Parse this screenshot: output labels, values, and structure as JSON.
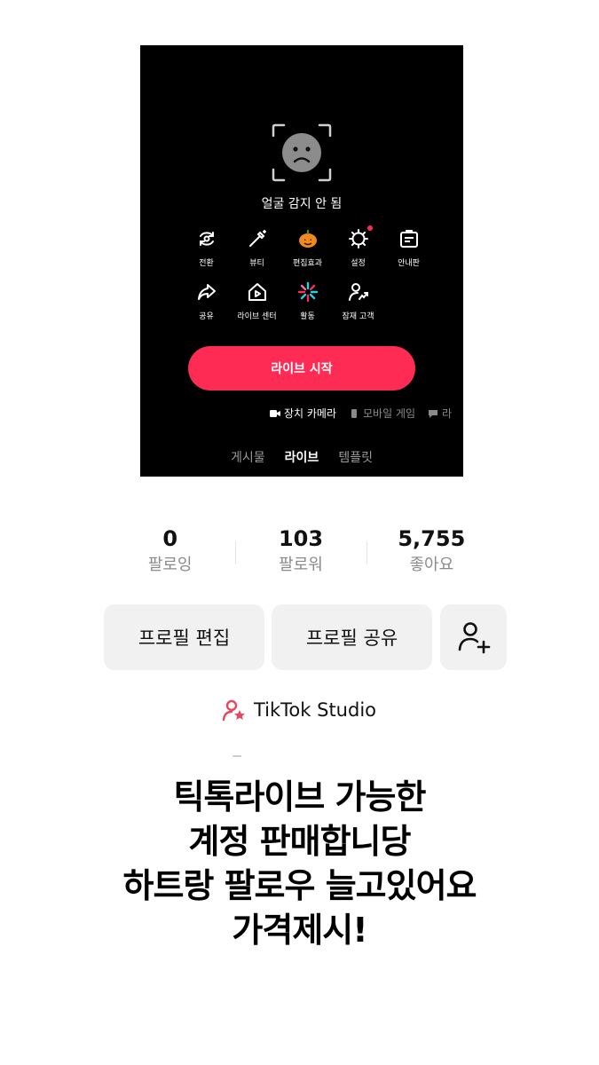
{
  "preview": {
    "face_message": "얼굴 감지 안 됨",
    "tools": [
      {
        "label": "전환",
        "icon": "camera-flip-icon",
        "dot": false
      },
      {
        "label": "뷰티",
        "icon": "magic-wand-icon",
        "dot": false
      },
      {
        "label": "편집효과",
        "icon": "pumpkin-effect-icon",
        "dot": false
      },
      {
        "label": "설정",
        "icon": "gear-icon",
        "dot": true
      },
      {
        "label": "안내판",
        "icon": "notice-board-icon",
        "dot": false
      },
      {
        "label": "공유",
        "icon": "share-arrow-icon",
        "dot": false
      },
      {
        "label": "라이브 센터",
        "icon": "live-center-home-icon",
        "dot": false
      },
      {
        "label": "활동",
        "icon": "activity-burst-icon",
        "dot": false
      },
      {
        "label": "잠재 고객",
        "icon": "potential-audience-icon",
        "dot": false
      }
    ],
    "go_live_label": "라이브 시작",
    "sources": [
      {
        "label": "장치 카메라",
        "icon": "video-camera-icon",
        "active": true
      },
      {
        "label": "모바일 게임",
        "icon": "phone-icon",
        "active": false
      },
      {
        "label": "라",
        "icon": "chat-icon",
        "active": false
      }
    ],
    "modes": [
      {
        "label": "게시물",
        "active": false
      },
      {
        "label": "라이브",
        "active": true
      },
      {
        "label": "템플릿",
        "active": false
      }
    ],
    "accent_color": "#fe2c55"
  },
  "stats": [
    {
      "value": "0",
      "label": "팔로잉"
    },
    {
      "value": "103",
      "label": "팔로워"
    },
    {
      "value": "5,755",
      "label": "좋아요"
    }
  ],
  "actions": {
    "edit_profile": "프로필 편집",
    "share_profile": "프로필 공유"
  },
  "studio": {
    "label": "TikTok Studio",
    "icon": "person-star-icon"
  },
  "caption": {
    "lines": [
      "틱톡라이브 가능한",
      "계정 판매합니당",
      "하트랑 팔로우 늘고있어요",
      "가격제시!"
    ]
  }
}
